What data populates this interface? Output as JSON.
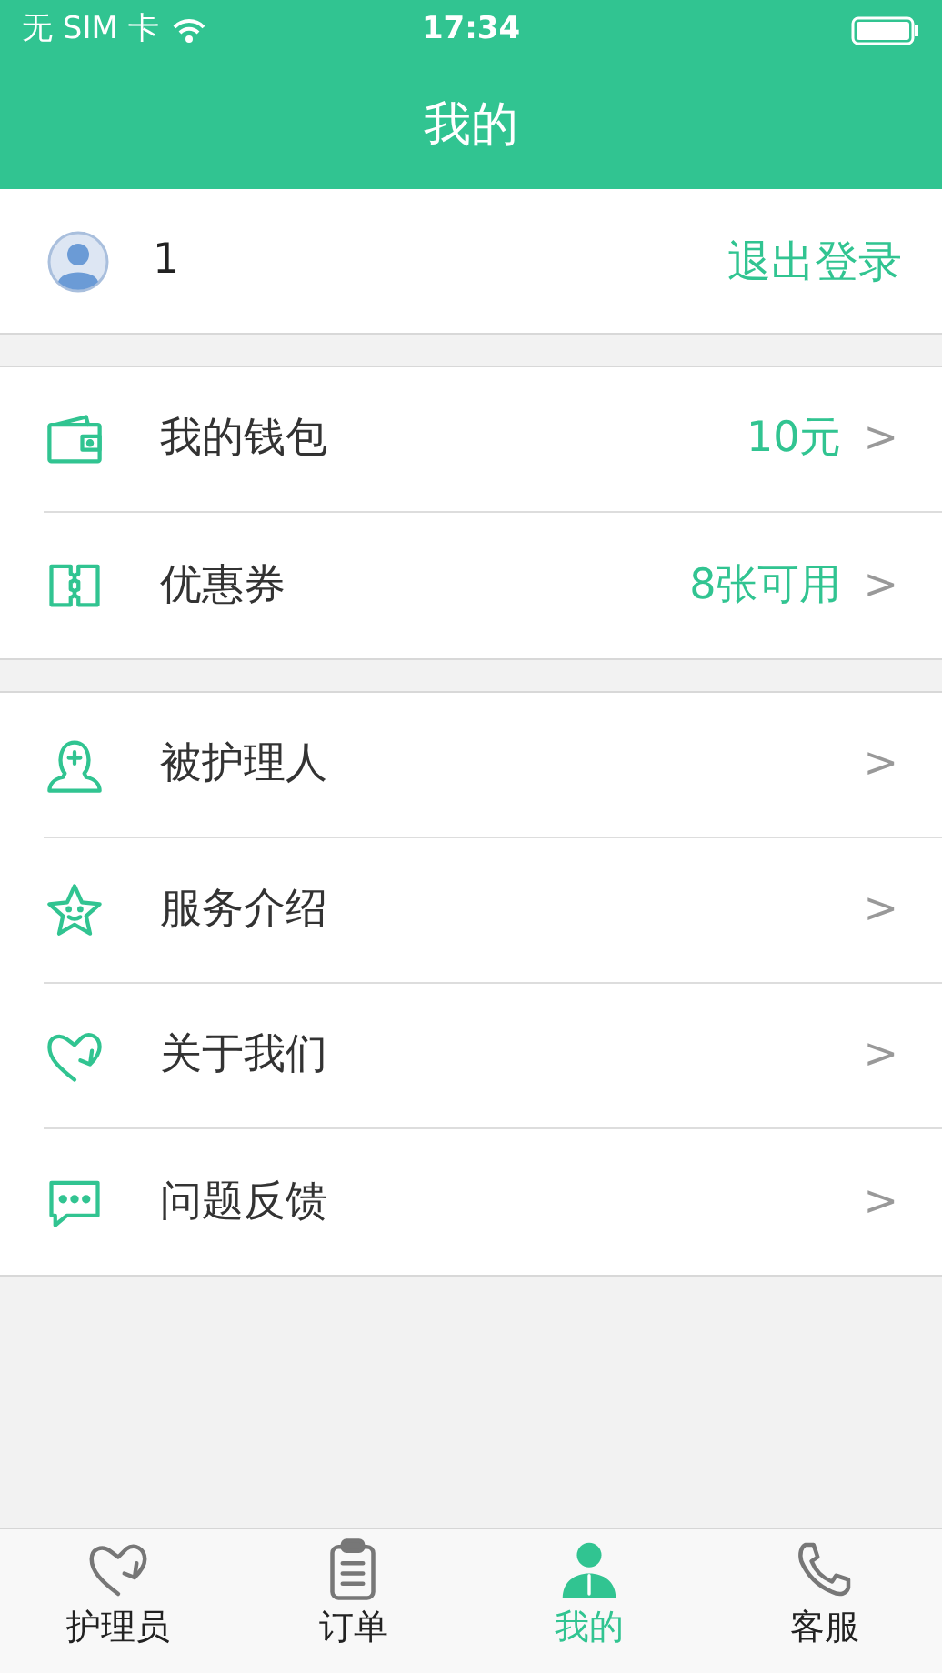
{
  "status_bar": {
    "carrier": "无 SIM 卡",
    "time": "17:34"
  },
  "header": {
    "title": "我的"
  },
  "profile": {
    "phone": "1",
    "logout": "退出登录"
  },
  "groups": [
    {
      "items": [
        {
          "label": "我的钱包",
          "value": "10元",
          "chevron": ">"
        },
        {
          "label": "优惠券",
          "value": "8张可用",
          "chevron": ">"
        }
      ]
    },
    {
      "items": [
        {
          "label": "被护理人",
          "chevron": ">"
        },
        {
          "label": "服务介绍",
          "chevron": ">"
        },
        {
          "label": "关于我们",
          "chevron": ">"
        },
        {
          "label": "问题反馈",
          "chevron": ">"
        }
      ]
    }
  ],
  "tab_bar": [
    {
      "label": "护理员",
      "selected": false
    },
    {
      "label": "订单",
      "selected": false
    },
    {
      "label": "我的",
      "selected": true
    },
    {
      "label": "客服",
      "selected": false
    }
  ]
}
